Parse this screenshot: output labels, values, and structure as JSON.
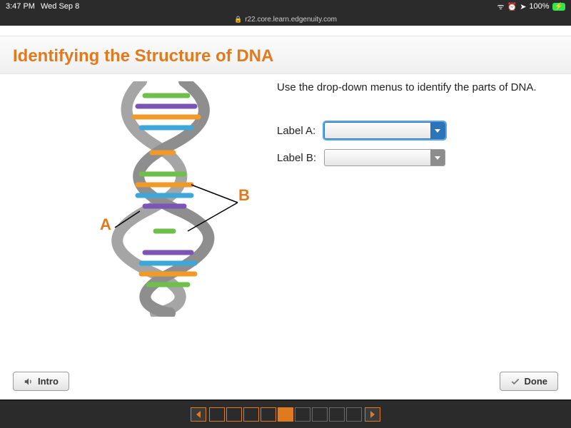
{
  "status": {
    "time": "3:47 PM",
    "date": "Wed Sep 8",
    "battery_pct": "100%",
    "battery_icon": "⚡"
  },
  "browser": {
    "url": "r22.core.learn.edgenuity.com"
  },
  "lesson": {
    "title": "Identifying the Structure of DNA",
    "instruction": "Use the drop-down menus to identify the parts of DNA.",
    "fields": {
      "a_label": "Label A:",
      "b_label": "Label B:"
    },
    "figure_labels": {
      "A": "A",
      "B": "B"
    }
  },
  "buttons": {
    "intro": "Intro",
    "done": "Done"
  },
  "progress": {
    "cells": [
      "empty",
      "empty",
      "empty",
      "empty",
      "fill",
      "dim",
      "dim",
      "dim",
      "dim"
    ]
  }
}
